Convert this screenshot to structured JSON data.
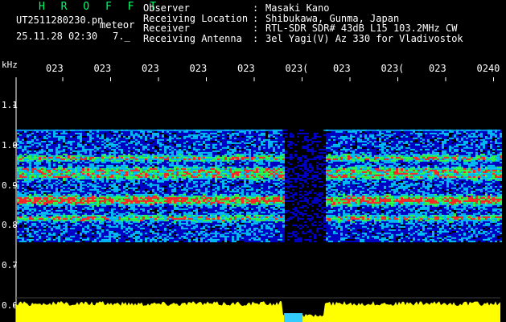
{
  "header": {
    "title": "H R O F F T",
    "filename": "UT2511280230.pn",
    "type": "meteor",
    "datetime": "25.11.28 02:30",
    "value": "7._"
  },
  "station": [
    {
      "label": "Observer",
      "sep": ":",
      "value": "Masaki Kano"
    },
    {
      "label": "Receiving Location",
      "sep": ":",
      "value": "Shibukawa, Gunma, Japan"
    },
    {
      "label": "Receiver",
      "sep": ":",
      "value": "RTL-SDR SDR# 43dB L15 103.2MHz CW"
    },
    {
      "label": "Receiving Antenna",
      "sep": ":",
      "value": "3el Yagi(V) Az 330 for Vladivostok"
    }
  ],
  "axis": {
    "unit": "kHz",
    "y_labels": [
      "1.1",
      "1.0",
      "0.9",
      "0.8",
      "0.7",
      "0.6"
    ],
    "x_labels": [
      "023",
      "023",
      "023",
      "023",
      "023",
      "023(",
      "023",
      "023(",
      "023",
      "0240"
    ]
  },
  "colors": {
    "background": "#000000",
    "band_low": "#0000cc",
    "band_mid": "#00c0ff",
    "band_green": "#30ff50",
    "band_red": "#ff2a2a",
    "signal_level": "#ffff00",
    "gap_marker": "#33ccff"
  },
  "spectrogram": {
    "band_top_khz": 1.04,
    "band_bottom_khz": 0.76,
    "gap_start_fraction": 0.55,
    "gap_end_fraction": 0.635
  }
}
